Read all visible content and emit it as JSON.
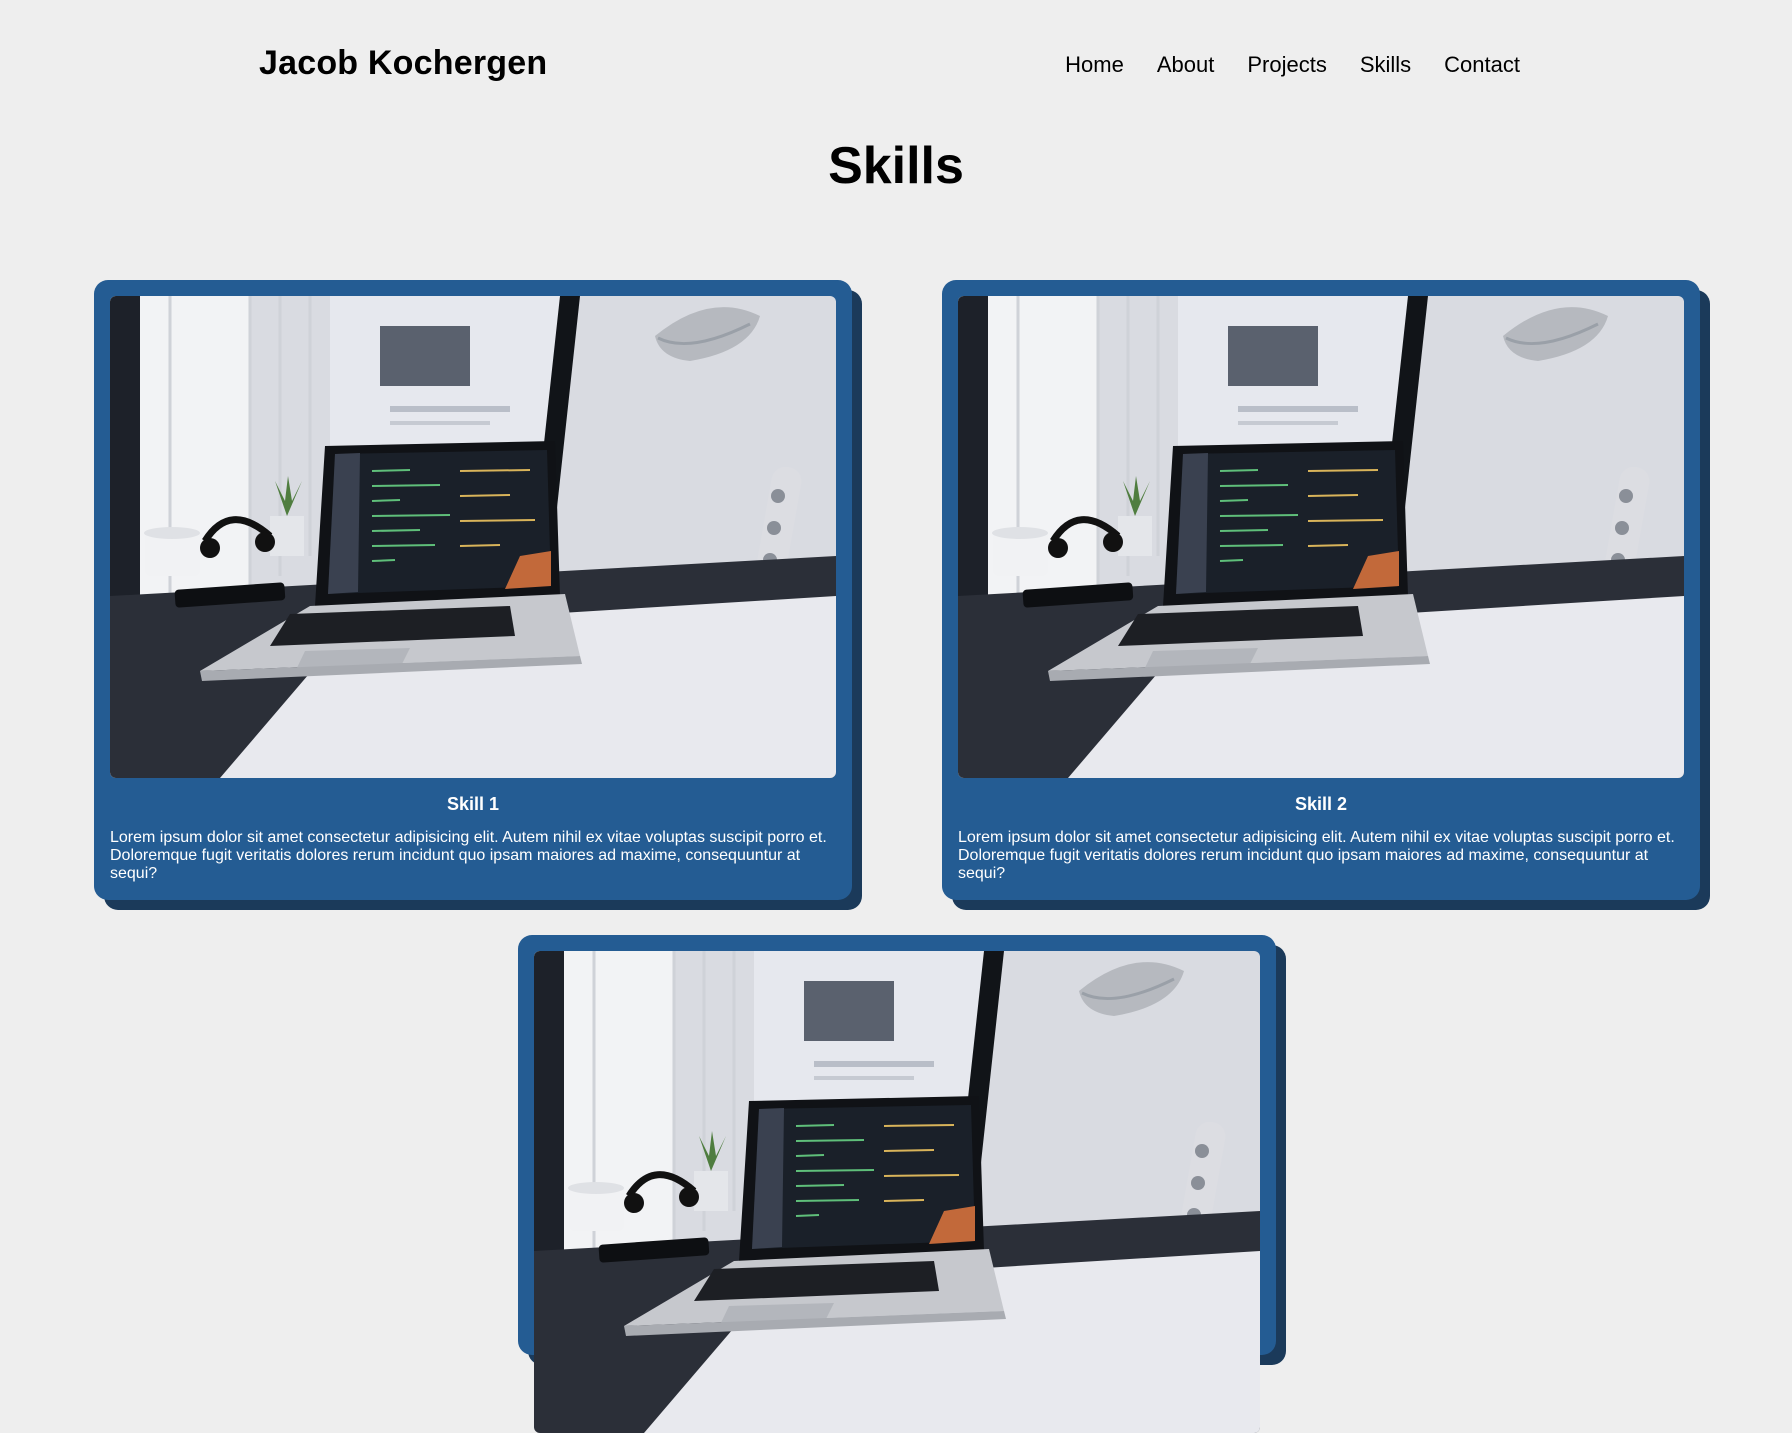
{
  "header": {
    "brand": "Jacob Kochergen",
    "nav": [
      "Home",
      "About",
      "Projects",
      "Skills",
      "Contact"
    ]
  },
  "page_title": "Skills",
  "skills": [
    {
      "name": "Skill 1",
      "description": "Lorem ipsum dolor sit amet consectetur adipisicing elit. Autem nihil ex vitae voluptas suscipit porro et. Doloremque fugit veritatis dolores rerum incidunt quo ipsam maiores ad maxime, consequuntur at sequi?"
    },
    {
      "name": "Skill 2",
      "description": "Lorem ipsum dolor sit amet consectetur adipisicing elit. Autem nihil ex vitae voluptas suscipit porro et. Doloremque fugit veritatis dolores rerum incidunt quo ipsam maiores ad maxime, consequuntur at sequi?"
    },
    {
      "name": "",
      "description": ""
    }
  ],
  "colors": {
    "background": "#eeeeee",
    "card": "#245c93",
    "card_shadow": "#1b3a5a"
  },
  "icons": {
    "card_image": "laptop-desk-photo"
  }
}
